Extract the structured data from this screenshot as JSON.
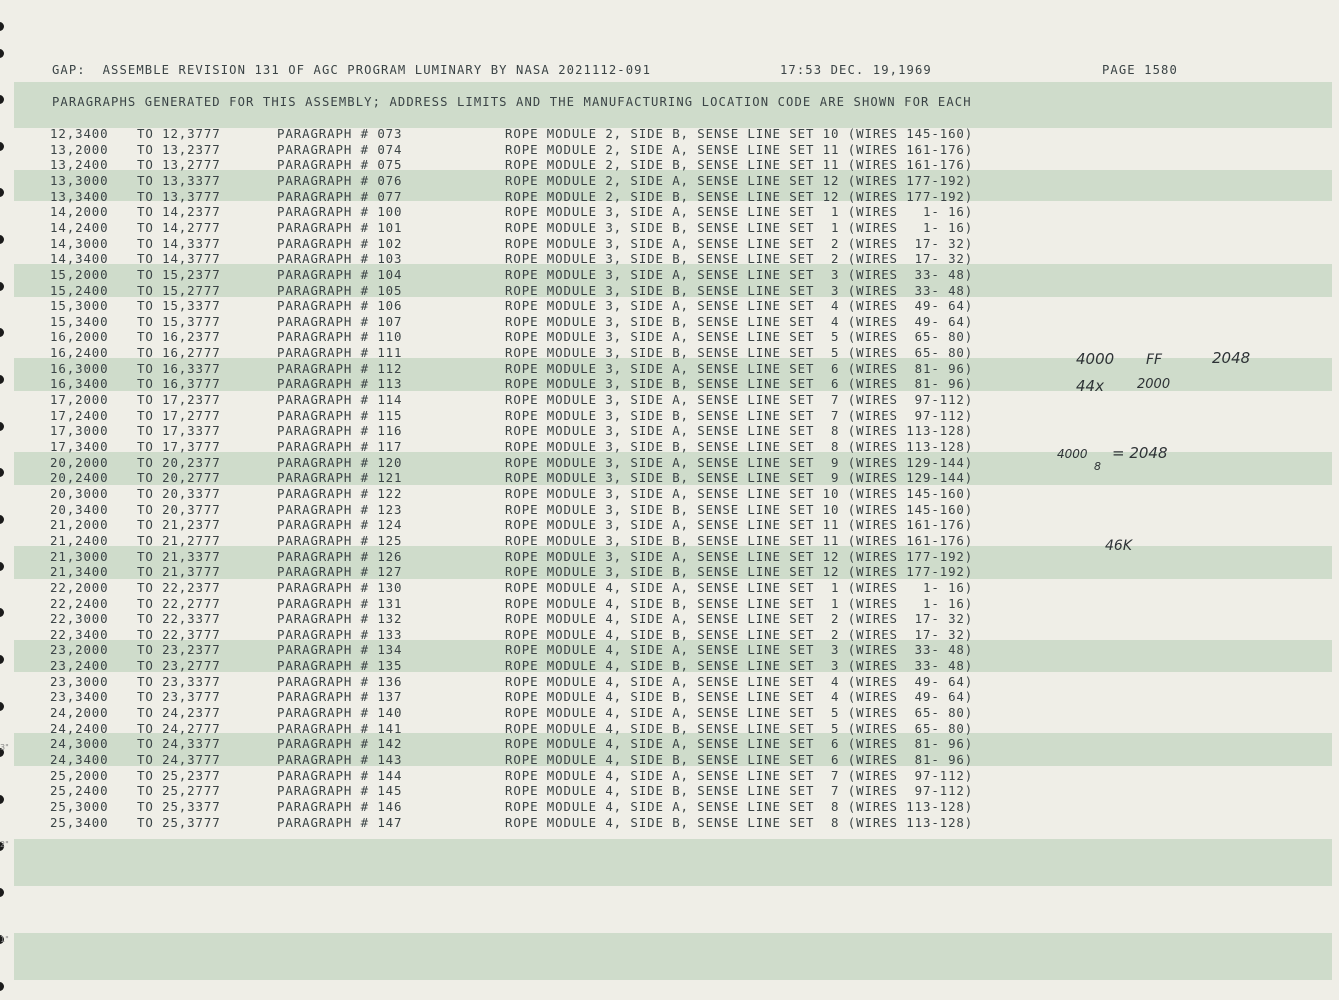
{
  "header": {
    "line1_left": "GAP:  ASSEMBLE REVISION 131 OF AGC PROGRAM LUMINARY BY NASA 2021112-091",
    "line1_time": "17:53 DEC. 19,1969",
    "line1_page": "PAGE 1580",
    "line2": "PARAGRAPHS GENERATED FOR THIS ASSEMBLY; ADDRESS LIMITS AND THE MANUFACTURING LOCATION CODE ARE SHOWN FOR EACH"
  },
  "rows": [
    {
      "from": "12,3400",
      "to": "TO 12,3777",
      "para": "PARAGRAPH # 073",
      "rope": "ROPE MODULE 2, SIDE B, SENSE LINE SET 10 (WIRES 145-160)"
    },
    {
      "from": "13,2000",
      "to": "TO 13,2377",
      "para": "PARAGRAPH # 074",
      "rope": "ROPE MODULE 2, SIDE A, SENSE LINE SET 11 (WIRES 161-176)"
    },
    {
      "from": "13,2400",
      "to": "TO 13,2777",
      "para": "PARAGRAPH # 075",
      "rope": "ROPE MODULE 2, SIDE B, SENSE LINE SET 11 (WIRES 161-176)"
    },
    {
      "from": "13,3000",
      "to": "TO 13,3377",
      "para": "PARAGRAPH # 076",
      "rope": "ROPE MODULE 2, SIDE A, SENSE LINE SET 12 (WIRES 177-192)"
    },
    {
      "from": "13,3400",
      "to": "TO 13,3777",
      "para": "PARAGRAPH # 077",
      "rope": "ROPE MODULE 2, SIDE B, SENSE LINE SET 12 (WIRES 177-192)"
    },
    {
      "from": "14,2000",
      "to": "TO 14,2377",
      "para": "PARAGRAPH # 100",
      "rope": "ROPE MODULE 3, SIDE A, SENSE LINE SET  1 (WIRES   1- 16)"
    },
    {
      "from": "14,2400",
      "to": "TO 14,2777",
      "para": "PARAGRAPH # 101",
      "rope": "ROPE MODULE 3, SIDE B, SENSE LINE SET  1 (WIRES   1- 16)"
    },
    {
      "from": "14,3000",
      "to": "TO 14,3377",
      "para": "PARAGRAPH # 102",
      "rope": "ROPE MODULE 3, SIDE A, SENSE LINE SET  2 (WIRES  17- 32)"
    },
    {
      "from": "14,3400",
      "to": "TO 14,3777",
      "para": "PARAGRAPH # 103",
      "rope": "ROPE MODULE 3, SIDE B, SENSE LINE SET  2 (WIRES  17- 32)"
    },
    {
      "from": "15,2000",
      "to": "TO 15,2377",
      "para": "PARAGRAPH # 104",
      "rope": "ROPE MODULE 3, SIDE A, SENSE LINE SET  3 (WIRES  33- 48)"
    },
    {
      "from": "15,2400",
      "to": "TO 15,2777",
      "para": "PARAGRAPH # 105",
      "rope": "ROPE MODULE 3, SIDE B, SENSE LINE SET  3 (WIRES  33- 48)"
    },
    {
      "from": "15,3000",
      "to": "TO 15,3377",
      "para": "PARAGRAPH # 106",
      "rope": "ROPE MODULE 3, SIDE A, SENSE LINE SET  4 (WIRES  49- 64)"
    },
    {
      "from": "15,3400",
      "to": "TO 15,3777",
      "para": "PARAGRAPH # 107",
      "rope": "ROPE MODULE 3, SIDE B, SENSE LINE SET  4 (WIRES  49- 64)"
    },
    {
      "from": "16,2000",
      "to": "TO 16,2377",
      "para": "PARAGRAPH # 110",
      "rope": "ROPE MODULE 3, SIDE A, SENSE LINE SET  5 (WIRES  65- 80)"
    },
    {
      "from": "16,2400",
      "to": "TO 16,2777",
      "para": "PARAGRAPH # 111",
      "rope": "ROPE MODULE 3, SIDE B, SENSE LINE SET  5 (WIRES  65- 80)"
    },
    {
      "from": "16,3000",
      "to": "TO 16,3377",
      "para": "PARAGRAPH # 112",
      "rope": "ROPE MODULE 3, SIDE A, SENSE LINE SET  6 (WIRES  81- 96)"
    },
    {
      "from": "16,3400",
      "to": "TO 16,3777",
      "para": "PARAGRAPH # 113",
      "rope": "ROPE MODULE 3, SIDE B, SENSE LINE SET  6 (WIRES  81- 96)"
    },
    {
      "from": "17,2000",
      "to": "TO 17,2377",
      "para": "PARAGRAPH # 114",
      "rope": "ROPE MODULE 3, SIDE A, SENSE LINE SET  7 (WIRES  97-112)"
    },
    {
      "from": "17,2400",
      "to": "TO 17,2777",
      "para": "PARAGRAPH # 115",
      "rope": "ROPE MODULE 3, SIDE B, SENSE LINE SET  7 (WIRES  97-112)"
    },
    {
      "from": "17,3000",
      "to": "TO 17,3377",
      "para": "PARAGRAPH # 116",
      "rope": "ROPE MODULE 3, SIDE A, SENSE LINE SET  8 (WIRES 113-128)"
    },
    {
      "from": "17,3400",
      "to": "TO 17,3777",
      "para": "PARAGRAPH # 117",
      "rope": "ROPE MODULE 3, SIDE B, SENSE LINE SET  8 (WIRES 113-128)"
    },
    {
      "from": "20,2000",
      "to": "TO 20,2377",
      "para": "PARAGRAPH # 120",
      "rope": "ROPE MODULE 3, SIDE A, SENSE LINE SET  9 (WIRES 129-144)"
    },
    {
      "from": "20,2400",
      "to": "TO 20,2777",
      "para": "PARAGRAPH # 121",
      "rope": "ROPE MODULE 3, SIDE B, SENSE LINE SET  9 (WIRES 129-144)"
    },
    {
      "from": "20,3000",
      "to": "TO 20,3377",
      "para": "PARAGRAPH # 122",
      "rope": "ROPE MODULE 3, SIDE A, SENSE LINE SET 10 (WIRES 145-160)"
    },
    {
      "from": "20,3400",
      "to": "TO 20,3777",
      "para": "PARAGRAPH # 123",
      "rope": "ROPE MODULE 3, SIDE B, SENSE LINE SET 10 (WIRES 145-160)"
    },
    {
      "from": "21,2000",
      "to": "TO 21,2377",
      "para": "PARAGRAPH # 124",
      "rope": "ROPE MODULE 3, SIDE A, SENSE LINE SET 11 (WIRES 161-176)"
    },
    {
      "from": "21,2400",
      "to": "TO 21,2777",
      "para": "PARAGRAPH # 125",
      "rope": "ROPE MODULE 3, SIDE B, SENSE LINE SET 11 (WIRES 161-176)"
    },
    {
      "from": "21,3000",
      "to": "TO 21,3377",
      "para": "PARAGRAPH # 126",
      "rope": "ROPE MODULE 3, SIDE A, SENSE LINE SET 12 (WIRES 177-192)"
    },
    {
      "from": "21,3400",
      "to": "TO 21,3777",
      "para": "PARAGRAPH # 127",
      "rope": "ROPE MODULE 3, SIDE B, SENSE LINE SET 12 (WIRES 177-192)"
    },
    {
      "from": "22,2000",
      "to": "TO 22,2377",
      "para": "PARAGRAPH # 130",
      "rope": "ROPE MODULE 4, SIDE A, SENSE LINE SET  1 (WIRES   1- 16)"
    },
    {
      "from": "22,2400",
      "to": "TO 22,2777",
      "para": "PARAGRAPH # 131",
      "rope": "ROPE MODULE 4, SIDE B, SENSE LINE SET  1 (WIRES   1- 16)"
    },
    {
      "from": "22,3000",
      "to": "TO 22,3377",
      "para": "PARAGRAPH # 132",
      "rope": "ROPE MODULE 4, SIDE A, SENSE LINE SET  2 (WIRES  17- 32)"
    },
    {
      "from": "22,3400",
      "to": "TO 22,3777",
      "para": "PARAGRAPH # 133",
      "rope": "ROPE MODULE 4, SIDE B, SENSE LINE SET  2 (WIRES  17- 32)"
    },
    {
      "from": "23,2000",
      "to": "TO 23,2377",
      "para": "PARAGRAPH # 134",
      "rope": "ROPE MODULE 4, SIDE A, SENSE LINE SET  3 (WIRES  33- 48)"
    },
    {
      "from": "23,2400",
      "to": "TO 23,2777",
      "para": "PARAGRAPH # 135",
      "rope": "ROPE MODULE 4, SIDE B, SENSE LINE SET  3 (WIRES  33- 48)"
    },
    {
      "from": "23,3000",
      "to": "TO 23,3377",
      "para": "PARAGRAPH # 136",
      "rope": "ROPE MODULE 4, SIDE A, SENSE LINE SET  4 (WIRES  49- 64)"
    },
    {
      "from": "23,3400",
      "to": "TO 23,3777",
      "para": "PARAGRAPH # 137",
      "rope": "ROPE MODULE 4, SIDE B, SENSE LINE SET  4 (WIRES  49- 64)"
    },
    {
      "from": "24,2000",
      "to": "TO 24,2377",
      "para": "PARAGRAPH # 140",
      "rope": "ROPE MODULE 4, SIDE A, SENSE LINE SET  5 (WIRES  65- 80)"
    },
    {
      "from": "24,2400",
      "to": "TO 24,2777",
      "para": "PARAGRAPH # 141",
      "rope": "ROPE MODULE 4, SIDE B, SENSE LINE SET  5 (WIRES  65- 80)"
    },
    {
      "from": "24,3000",
      "to": "TO 24,3377",
      "para": "PARAGRAPH # 142",
      "rope": "ROPE MODULE 4, SIDE A, SENSE LINE SET  6 (WIRES  81- 96)"
    },
    {
      "from": "24,3400",
      "to": "TO 24,3777",
      "para": "PARAGRAPH # 143",
      "rope": "ROPE MODULE 4, SIDE B, SENSE LINE SET  6 (WIRES  81- 96)"
    },
    {
      "from": "25,2000",
      "to": "TO 25,2377",
      "para": "PARAGRAPH # 144",
      "rope": "ROPE MODULE 4, SIDE A, SENSE LINE SET  7 (WIRES  97-112)"
    },
    {
      "from": "25,2400",
      "to": "TO 25,2777",
      "para": "PARAGRAPH # 145",
      "rope": "ROPE MODULE 4, SIDE B, SENSE LINE SET  7 (WIRES  97-112)"
    },
    {
      "from": "25,3000",
      "to": "TO 25,3377",
      "para": "PARAGRAPH # 146",
      "rope": "ROPE MODULE 4, SIDE A, SENSE LINE SET  8 (WIRES 113-128)"
    },
    {
      "from": "25,3400",
      "to": "TO 25,3777",
      "para": "PARAGRAPH # 147",
      "rope": "ROPE MODULE 4, SIDE B, SENSE LINE SET  8 (WIRES 113-128)"
    }
  ],
  "annotations": {
    "note1_a": "4000",
    "note1_b": "FF",
    "note1_c": "2048",
    "note2_a": "44x",
    "note2_b": "2000",
    "note3_a": "4000",
    "note3_sub": "8",
    "note3_b": "= 2048",
    "note4": "46K"
  },
  "margin_marks": [
    "3\"",
    "2\"",
    "1\""
  ],
  "colors": {
    "paper": "#efeee7",
    "band": "#cfdccb",
    "ink": "#3b4446"
  }
}
